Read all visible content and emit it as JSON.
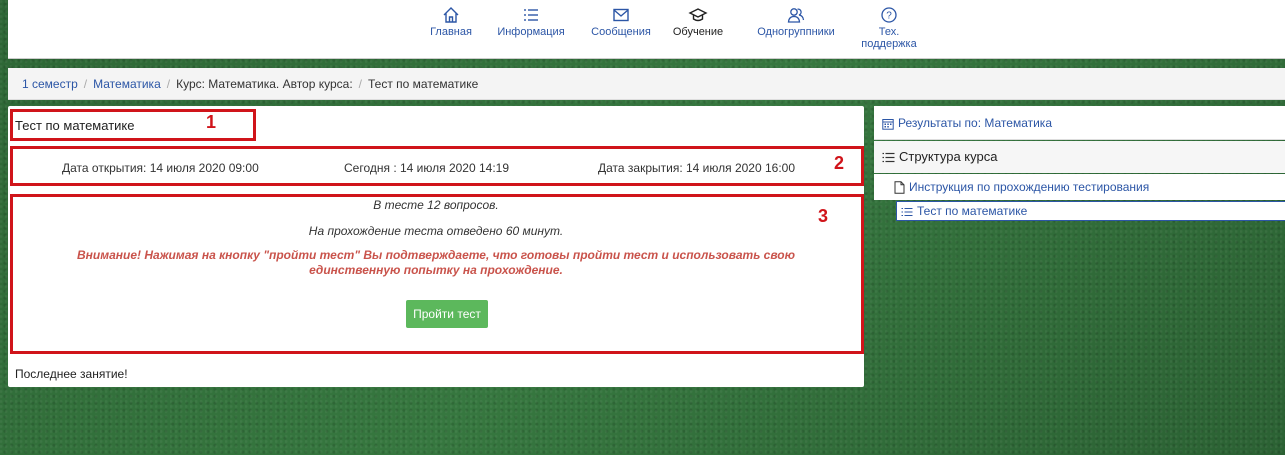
{
  "nav": {
    "items": [
      {
        "label": "Главная",
        "icon": "home-icon"
      },
      {
        "label": "Информация",
        "icon": "list-icon"
      },
      {
        "label": "Сообщения",
        "icon": "envelope-icon"
      },
      {
        "label": "Обучение",
        "icon": "graduation-cap-icon"
      },
      {
        "label": "Одногруппники",
        "icon": "users-icon"
      },
      {
        "label": "Тех. поддержка",
        "icon": "help-icon"
      }
    ],
    "active_index": 3
  },
  "breadcrumb": {
    "items": [
      "1 семестр",
      "Математика",
      "Курс: Математика. Автор курса:",
      "Тест по математике"
    ]
  },
  "test": {
    "title": "Тест по математике",
    "open_date": "Дата открытия: 14 июля 2020 09:00",
    "today": "Сегодня : 14 июля 2020 14:19",
    "close_date": "Дата закрытия: 14 июля 2020 16:00",
    "questions": "В тесте 12 вопросов.",
    "time_limit": "На прохождение теста отведено 60 минут.",
    "warning_line1": "Внимание! Нажимая на кнопку \"пройти тест\" Вы подтверждаете, что готовы пройти тест и использовать свою",
    "warning_line2": "единственную попытку на прохождение.",
    "start_button": "Пройти тест",
    "last_note": "Последнее занятие!"
  },
  "markers": {
    "m1": "1",
    "m2": "2",
    "m3": "3"
  },
  "sidebar": {
    "results_label": "Результаты по: Математика",
    "structure_label": "Структура курса",
    "items": [
      {
        "label": "Инструкция по прохождению тестирования",
        "icon": "document-icon"
      },
      {
        "label": "Тест по математике",
        "icon": "list-icon"
      }
    ]
  },
  "colors": {
    "accent": "#2c56a6",
    "highlight": "#d0141a",
    "button": "#5cb85c",
    "warning": "#c9534b"
  }
}
